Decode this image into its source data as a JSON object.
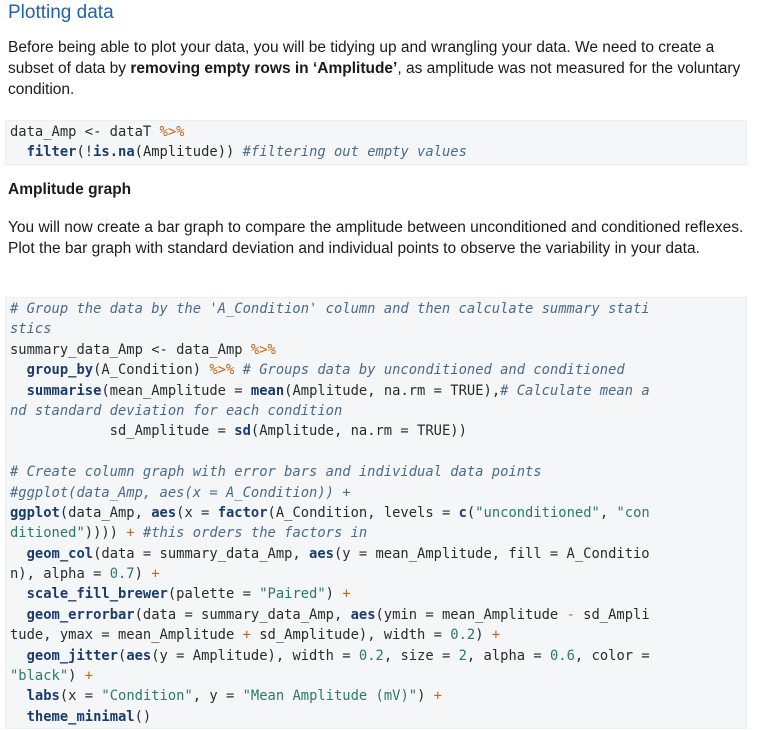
{
  "heading": "Plotting data",
  "intro": {
    "prefix": "Before being able to plot your data, you will be tidying up and wrangling your data. We need to create a subset of data by ",
    "bold": "removing empty rows in ‘Amplitude’",
    "suffix": ", as amplitude was not measured for the voluntary condition."
  },
  "code1": [
    [
      [
        "pl",
        "data_Amp <- dataT "
      ],
      [
        "op",
        "%>%"
      ]
    ],
    [
      [
        "pl",
        "  "
      ],
      [
        "fn",
        "filter"
      ],
      [
        "pl",
        "(!"
      ],
      [
        "fn",
        "is.na"
      ],
      [
        "pl",
        "(Amplitude)) "
      ],
      [
        "cm",
        "#filtering out empty values"
      ]
    ]
  ],
  "subheading": "Amplitude graph",
  "para2": "You will now create a bar graph to compare the amplitude between unconditioned and conditioned reflexes. Plot the bar graph with standard deviation and individual points to observe the variability in your data.",
  "code2": [
    [
      [
        "cm",
        "# Group the data by the 'A_Condition' column and then calculate summary stati"
      ]
    ],
    [
      [
        "cm",
        "stics"
      ]
    ],
    [
      [
        "pl",
        "summary_data_Amp <- data_Amp "
      ],
      [
        "op",
        "%>%"
      ]
    ],
    [
      [
        "pl",
        "  "
      ],
      [
        "fn",
        "group_by"
      ],
      [
        "pl",
        "(A_Condition) "
      ],
      [
        "op",
        "%>%"
      ],
      [
        "pl",
        " "
      ],
      [
        "cm",
        "# Groups data by unconditioned and conditioned"
      ]
    ],
    [
      [
        "pl",
        "  "
      ],
      [
        "fn",
        "summarise"
      ],
      [
        "pl",
        "(mean_Amplitude = "
      ],
      [
        "fn",
        "mean"
      ],
      [
        "pl",
        "(Amplitude, na.rm = TRUE),"
      ],
      [
        "cm",
        "# Calculate mean a"
      ]
    ],
    [
      [
        "cm",
        "nd standard deviation for each condition"
      ]
    ],
    [
      [
        "pl",
        "            sd_Amplitude = "
      ],
      [
        "fn",
        "sd"
      ],
      [
        "pl",
        "(Amplitude, na.rm = TRUE))"
      ]
    ],
    [
      [
        "pl",
        ""
      ]
    ],
    [
      [
        "cm",
        "# Create column graph with error bars and individual data points"
      ]
    ],
    [
      [
        "cm",
        "#ggplot(data_Amp, aes(x = A_Condition)) +"
      ]
    ],
    [
      [
        "fn",
        "ggplot"
      ],
      [
        "pl",
        "(data_Amp, "
      ],
      [
        "fn",
        "aes"
      ],
      [
        "pl",
        "(x = "
      ],
      [
        "fn",
        "factor"
      ],
      [
        "pl",
        "(A_Condition, levels = "
      ],
      [
        "fn",
        "c"
      ],
      [
        "pl",
        "("
      ],
      [
        "str",
        "\"unconditioned\""
      ],
      [
        "pl",
        ", "
      ],
      [
        "str",
        "\"con"
      ]
    ],
    [
      [
        "str",
        "ditioned\""
      ],
      [
        "pl",
        "))))"
      ],
      [
        "op",
        " +"
      ],
      [
        "pl",
        " "
      ],
      [
        "cm",
        "#this orders the factors in"
      ]
    ],
    [
      [
        "pl",
        "  "
      ],
      [
        "fn",
        "geom_col"
      ],
      [
        "pl",
        "(data = summary_data_Amp, "
      ],
      [
        "fn",
        "aes"
      ],
      [
        "pl",
        "(y = mean_Amplitude, fill = A_Conditio"
      ]
    ],
    [
      [
        "pl",
        "n), alpha = "
      ],
      [
        "num",
        "0.7"
      ],
      [
        "pl",
        ")"
      ],
      [
        "op",
        " +"
      ]
    ],
    [
      [
        "pl",
        "  "
      ],
      [
        "fn",
        "scale_fill_brewer"
      ],
      [
        "pl",
        "(palette = "
      ],
      [
        "str",
        "\"Paired\""
      ],
      [
        "pl",
        ")"
      ],
      [
        "op",
        " +"
      ]
    ],
    [
      [
        "pl",
        "  "
      ],
      [
        "fn",
        "geom_errorbar"
      ],
      [
        "pl",
        "(data = summary_data_Amp, "
      ],
      [
        "fn",
        "aes"
      ],
      [
        "pl",
        "(ymin = mean_Amplitude "
      ],
      [
        "op",
        "-"
      ],
      [
        "pl",
        " sd_Ampli"
      ]
    ],
    [
      [
        "pl",
        "tude, ymax = mean_Amplitude "
      ],
      [
        "op",
        "+"
      ],
      [
        "pl",
        " sd_Amplitude), width = "
      ],
      [
        "num",
        "0.2"
      ],
      [
        "pl",
        ")"
      ],
      [
        "op",
        " +"
      ]
    ],
    [
      [
        "pl",
        "  "
      ],
      [
        "fn",
        "geom_jitter"
      ],
      [
        "pl",
        "("
      ],
      [
        "fn",
        "aes"
      ],
      [
        "pl",
        "(y = Amplitude), width = "
      ],
      [
        "num",
        "0.2"
      ],
      [
        "pl",
        ", size = "
      ],
      [
        "num",
        "2"
      ],
      [
        "pl",
        ", alpha = "
      ],
      [
        "num",
        "0.6"
      ],
      [
        "pl",
        ", color ="
      ]
    ],
    [
      [
        "str",
        "\"black\""
      ],
      [
        "pl",
        ")"
      ],
      [
        "op",
        " +"
      ]
    ],
    [
      [
        "pl",
        "  "
      ],
      [
        "fn",
        "labs"
      ],
      [
        "pl",
        "(x = "
      ],
      [
        "str",
        "\"Condition\""
      ],
      [
        "pl",
        ", y = "
      ],
      [
        "str",
        "\"Mean Amplitude (mV)\""
      ],
      [
        "pl",
        ")"
      ],
      [
        "op",
        " +"
      ]
    ],
    [
      [
        "pl",
        "  "
      ],
      [
        "fn",
        "theme_minimal"
      ],
      [
        "pl",
        "()"
      ]
    ]
  ]
}
